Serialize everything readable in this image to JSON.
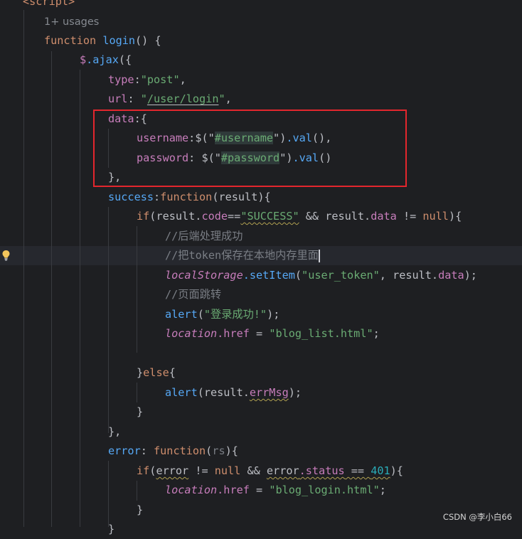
{
  "header": {
    "script_tag": "<script>",
    "usages_hint": "1+ usages"
  },
  "code": {
    "fn_kw": "function",
    "fn_name": "login",
    "fn_sig_rest": "() {",
    "ajax_obj": "$",
    "ajax_method": ".ajax",
    "ajax_open": "({",
    "type_key": "type",
    "type_val": "\"post\"",
    "url_key": "url",
    "url_val_q1": "\"",
    "url_val": "/user/login",
    "url_val_q2": "\"",
    "data_key": "data",
    "data_open": ":{",
    "username_key": "username",
    "username_sel": "$(\"",
    "username_id": "#username",
    "username_tail_q": "\")",
    "val_call": ".val",
    "username_end": "(),",
    "password_key": "password",
    "password_sel": " $(\"",
    "password_id": "#password",
    "password_tail_q": "\")",
    "password_end": "()",
    "data_close": "},",
    "success_key": "success",
    "success_fn_kw": "function",
    "success_params": "(result){",
    "if_kw": "if",
    "if_open": "(result.",
    "code_prop": "code",
    "eq": "==",
    "success_str": "\"SUCCESS\"",
    "and": " && result.",
    "data_prop": "data",
    "neq": " != ",
    "null_kw": "null",
    "if_close": "){",
    "comment_1": "//后端处理成功",
    "comment_2": "//把token保存在本地内存里面",
    "local_storage": "localStorage",
    "set_item": ".setItem",
    "set_item_open": "(",
    "token_key_str": "\"user_token\"",
    "set_item_mid": ", result.",
    "set_item_close": ");",
    "comment_3": "//页面跳转",
    "alert_fn": "alert",
    "alert_open": "(",
    "alert_msg": "\"登录成功!\"",
    "alert_close": ");",
    "location_obj": "location",
    "href_prop": ".href",
    "assign": " = ",
    "list_html": "\"blog_list.html\"",
    "semi": ";",
    "else_close": "}",
    "else_kw": "else",
    "else_open": "{",
    "alert_open2": "(result.",
    "err_msg_prop": "errMsg",
    "alert_close2": ");",
    "close_brace": "}",
    "close_brace_comma": "},",
    "error_key": "error",
    "error_colon": ": ",
    "error_fn_kw": "function",
    "error_params_open": "(",
    "error_param": "rs",
    "error_params_close": "){",
    "if2_kw": "if",
    "if2_open": "(",
    "error_word": "error",
    "if2_neq": " != ",
    "if2_null": "null",
    "if2_and": " && ",
    "error_word2": "error",
    "status_prop": ".status",
    "if2_eq": " == ",
    "status_401": "401",
    "if2_close": "){",
    "login_html": "\"blog_login.html\"",
    "last_brace": "}",
    "partial_last": "}"
  },
  "watermark": "CSDN @李小白66",
  "colors": {
    "background": "#1e1f22",
    "keyword": "#cf8e6d",
    "function": "#56a8f5",
    "string": "#6aab73",
    "property": "#c77dbb",
    "comment": "#7a7e85",
    "number": "#2aacb8",
    "annotation_box": "#e3262d"
  },
  "icons": {
    "gutter_hint": "lightbulb-icon"
  }
}
